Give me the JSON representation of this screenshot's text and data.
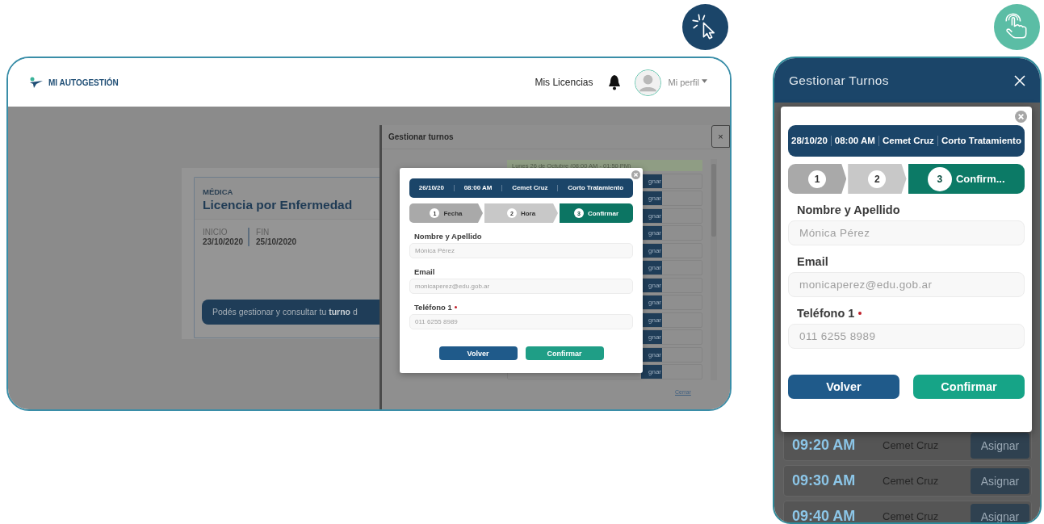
{
  "desktop": {
    "header": {
      "logo_text": "MI AUTOGESTIÓN",
      "nav_link": "Mis Licencias",
      "profile_label": "Mi perfil"
    },
    "license_card": {
      "category": "MÉDICA",
      "title": "Licencia por Enfermedad",
      "dates": [
        {
          "label": "INICIO",
          "value": "23/10/2020"
        },
        {
          "label": "FIN",
          "value": "25/10/2020"
        }
      ],
      "notice": "Podés gestionar y consultar tu **turno** d"
    },
    "panel": {
      "title": "Gestionar turnos",
      "close_label": "×",
      "day_header": "Lunes 26 de Octubre (08:00 AM - 01:50 PM)",
      "slots": [
        {
          "button": "gnar"
        },
        {
          "button": "gnar"
        },
        {
          "button": "gnar"
        },
        {
          "button": "gnar"
        },
        {
          "button": "gnar"
        },
        {
          "button": "gnar"
        },
        {
          "button": "gnar"
        },
        {
          "button": "gnar"
        },
        {
          "button": "gnar"
        },
        {
          "button": "gnar"
        },
        {
          "button": "gnar"
        },
        {
          "button": "gnar"
        }
      ],
      "close_link": "Cerrar"
    },
    "modal": {
      "summary": [
        "26/10/20",
        "08:00 AM",
        "Cemet Cruz",
        "Corto Tratamiento"
      ],
      "steps": [
        {
          "number": "1",
          "label": "Fecha",
          "selected": false
        },
        {
          "number": "2",
          "label": "Hora",
          "selected": false
        },
        {
          "number": "3",
          "label": "Confirmar",
          "selected": true
        }
      ],
      "fields": [
        {
          "label": "Nombre y Apellido",
          "required": false,
          "value": "Mónica Pérez"
        },
        {
          "label": "Email",
          "required": false,
          "value": "monicaperez@edu.gob.ar"
        },
        {
          "label": "Teléfono 1",
          "required": true,
          "value": "011 6255 8989"
        }
      ],
      "buttons": [
        {
          "label": "Volver",
          "kind": "secondary"
        },
        {
          "label": "Confirmar",
          "kind": "primary"
        }
      ]
    }
  },
  "mobile": {
    "title": "Gestionar Turnos",
    "modal": {
      "summary": [
        "28/10/20",
        "08:00 AM",
        "Cemet Cruz",
        "Corto Tratamiento"
      ],
      "steps": [
        {
          "number": "1",
          "selected": false
        },
        {
          "number": "2",
          "selected": false
        },
        {
          "number": "3",
          "label": "Confirm...",
          "selected": true
        }
      ],
      "fields": [
        {
          "label": "Nombre y Apellido",
          "required": false,
          "value": "Mónica Pérez"
        },
        {
          "label": "Email",
          "required": false,
          "value": "monicaperez@edu.gob.ar"
        },
        {
          "label": "Teléfono 1",
          "required": true,
          "value": "011 6255 8989"
        }
      ],
      "buttons": [
        {
          "label": "Volver",
          "kind": "secondary"
        },
        {
          "label": "Confirmar",
          "kind": "primary"
        }
      ]
    },
    "slots": [
      {
        "time": "09:20 AM",
        "doctor": "Cemet Cruz",
        "button": "Asignar"
      },
      {
        "time": "09:30 AM",
        "doctor": "Cemet Cruz",
        "button": "Asignar"
      },
      {
        "time": "09:40 AM",
        "doctor": "Cemet Cruz",
        "button": "Asignar"
      }
    ]
  }
}
